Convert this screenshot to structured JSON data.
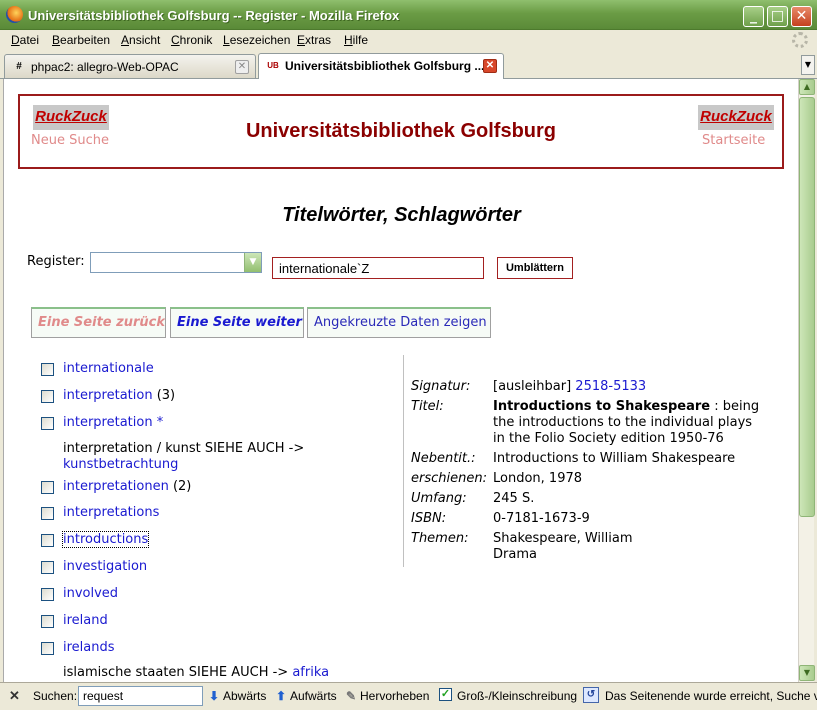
{
  "window": {
    "title": "Universitätsbibliothek Golfsburg -- Register - Mozilla Firefox",
    "buttons": {
      "minimize": "_",
      "maximize": "□",
      "close": "✕"
    }
  },
  "menu": [
    "Datei",
    "Bearbeiten",
    "Ansicht",
    "Chronik",
    "Lesezeichen",
    "Extras",
    "Hilfe"
  ],
  "tabs": [
    {
      "label": "phpac2: allegro-Web-OPAC",
      "icon": "webopac-icon",
      "active": false
    },
    {
      "label": "Universitätsbibliothek Golfsburg ...",
      "icon": "ub-icon",
      "active": true
    }
  ],
  "tab_icons": {
    "webopac": "#",
    "ub": "UB"
  },
  "header": {
    "title": "Universitätsbibliothek Golfsburg",
    "logo_left": {
      "text": "RuckZuck",
      "caption": "Neue Suche"
    },
    "logo_right": {
      "text": "RuckZuck",
      "caption": "Startseite"
    }
  },
  "page_subtitle": "Titelwörter, Schlagwörter",
  "register": {
    "label": "Register:",
    "select_value": "",
    "input_value": "internationale`Z",
    "button": "Umblättern"
  },
  "nav": {
    "back": "Eine Seite zurück",
    "next": "Eine Seite weiter",
    "show_checked": "Angekreuzte Daten zeigen"
  },
  "entries": [
    {
      "term": "internationale",
      "count": ""
    },
    {
      "term": "interpretation",
      "count": "(3)"
    },
    {
      "term": "interpretation",
      "count": "*"
    },
    {
      "term": "interpretationen",
      "count": "(2)"
    },
    {
      "term": "interpretations",
      "count": ""
    },
    {
      "term": "introductions",
      "count": ""
    },
    {
      "term": "investigation",
      "count": ""
    },
    {
      "term": "involved",
      "count": ""
    },
    {
      "term": "ireland",
      "count": ""
    },
    {
      "term": "irelands",
      "count": ""
    }
  ],
  "see_also": [
    {
      "text": "interpretation / kunst SIEHE AUCH ->",
      "link": "kunstbetrachtung"
    },
    {
      "text": "islamische staaten SIEHE AUCH ->",
      "link": "afrika"
    }
  ],
  "record": {
    "signatur_label": "Signatur:",
    "signatur_status": "[ausleihbar]",
    "signatur_link": "2518-5133",
    "titel_label": "Titel:",
    "titel_main": "Introductions to Shakespeare",
    "titel_rest": " : being the introductions to the individual plays in the Folio Society edition 1950-76",
    "nebentit_label": "Nebentit.:",
    "nebentit": "Introductions to William Shakespeare",
    "erschienen_label": "erschienen:",
    "erschienen": "London, 1978",
    "umfang_label": "Umfang:",
    "umfang": "245 S.",
    "isbn_label": "ISBN:",
    "isbn": "0-7181-1673-9",
    "themen_label": "Themen:",
    "themen": [
      "Shakespeare, William",
      "Drama"
    ]
  },
  "findbar": {
    "close": "✕",
    "label": "Suchen:",
    "value": "request",
    "down": "Abwärts",
    "up": "Aufwärts",
    "highlight": "Hervorheben",
    "match_case": "Groß-/Kleinschreibung",
    "match_case_checked": "✓",
    "status": "Das Seitenende wurde erreicht, Suche vom"
  }
}
